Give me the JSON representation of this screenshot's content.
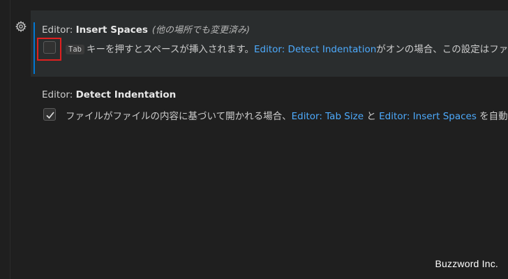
{
  "settings": [
    {
      "category": "Editor: ",
      "name": "Insert Spaces",
      "modified_note": "(他の場所でも変更済み)",
      "checked": false,
      "key": "Tab",
      "desc_part1": "キーを押すとスペースが挿入されます。",
      "link1": "Editor: Detect Indentation",
      "desc_part2": "がオンの場合、この設定はファイル"
    },
    {
      "category": "Editor: ",
      "name": "Detect Indentation",
      "checked": true,
      "desc_part1": "ファイルがファイルの内容に基づいて開かれる場合、",
      "link1": "Editor: Tab Size",
      "desc_part2": " と ",
      "link2": "Editor: Insert Spaces",
      "desc_part3": " を自動的にi"
    }
  ],
  "watermark": "Buzzword Inc.",
  "colors": {
    "link": "#4daafc",
    "highlight": "#e02020",
    "active_bar": "#0078d4"
  },
  "icons": {
    "gear": "gear-icon",
    "check": "check-icon"
  }
}
